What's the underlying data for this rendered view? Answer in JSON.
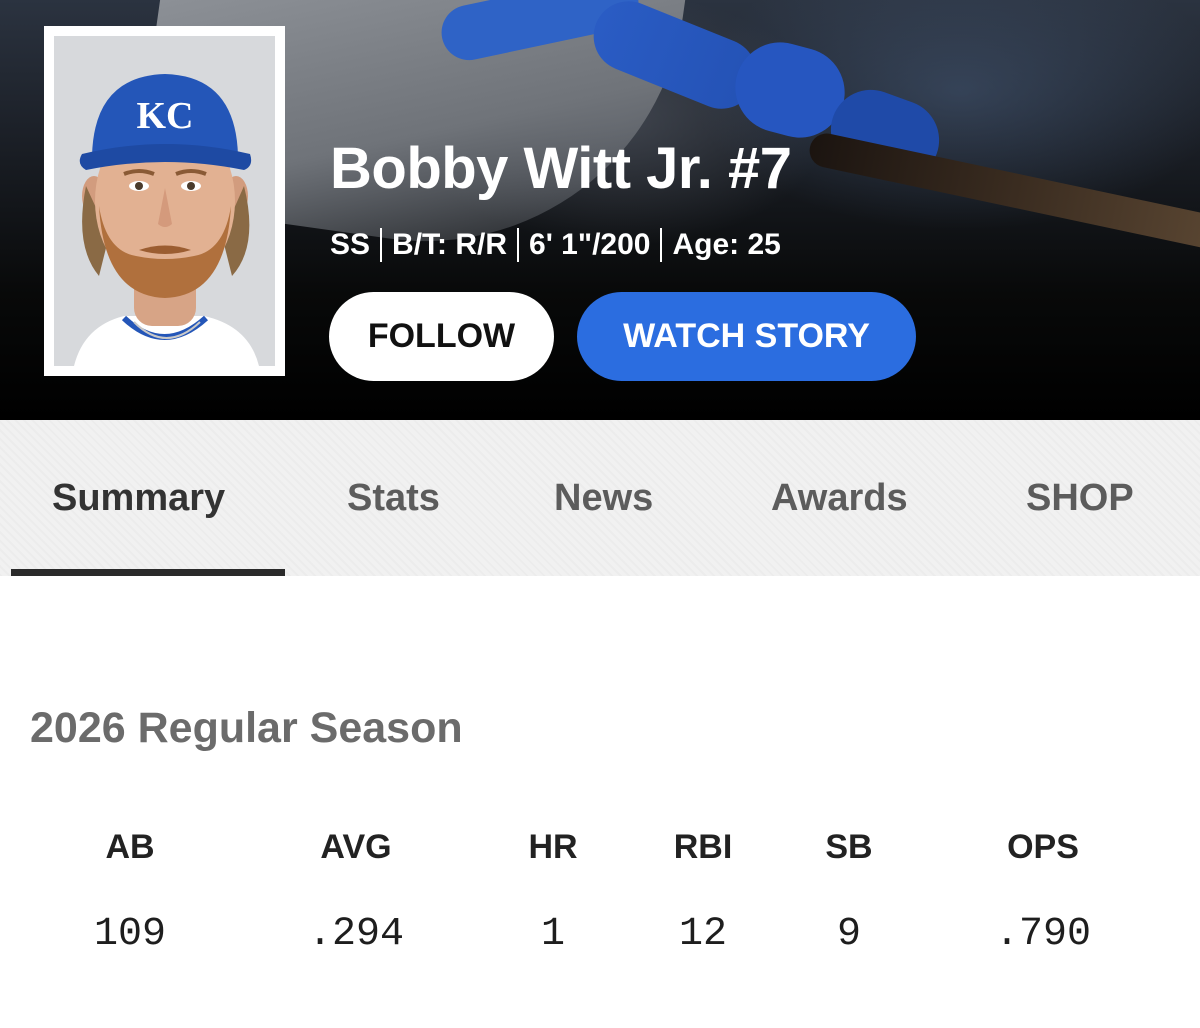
{
  "player": {
    "name": "Bobby Witt Jr. #7",
    "position": "SS",
    "bats_throws": "B/T: R/R",
    "height_weight": "6' 1\"/200",
    "age": "Age: 25",
    "cap_logo": "KC"
  },
  "actions": {
    "follow_label": "FOLLOW",
    "watch_story_label": "WATCH STORY"
  },
  "tabs": [
    {
      "label": "Summary",
      "active": true
    },
    {
      "label": "Stats",
      "active": false
    },
    {
      "label": "News",
      "active": false
    },
    {
      "label": "Awards",
      "active": false
    },
    {
      "label": "SHOP",
      "active": false
    }
  ],
  "season": {
    "title": "2026 Regular Season",
    "stats": [
      {
        "label": "AB",
        "value": "109"
      },
      {
        "label": "AVG",
        "value": ".294"
      },
      {
        "label": "HR",
        "value": "1"
      },
      {
        "label": "RBI",
        "value": "12"
      },
      {
        "label": "SB",
        "value": "9"
      },
      {
        "label": "OPS",
        "value": ".790"
      }
    ]
  },
  "colors": {
    "accent_blue": "#2b6de0",
    "royals_blue": "#2456b8",
    "hero_background": "#000000",
    "tab_underline": "#2a2a2a"
  }
}
